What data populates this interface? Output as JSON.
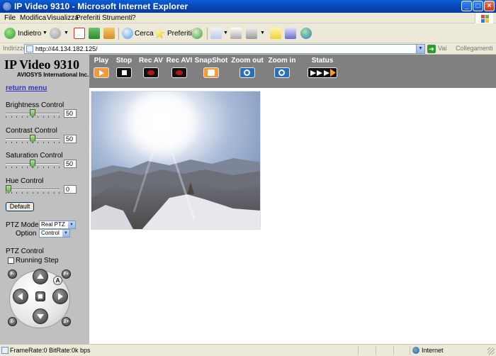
{
  "window": {
    "title": "IP Video 9310 - Microsoft Internet Explorer",
    "controls": {
      "minimize": "_",
      "maximize": "□",
      "close": "×"
    }
  },
  "menu": [
    "File",
    "Modifica",
    "Visualizza",
    "Preferiti",
    "Strumenti",
    "?"
  ],
  "toolbar": {
    "back": "Indietro",
    "search": "Cerca",
    "favorites": "Preferiti"
  },
  "address": {
    "label": "Indirizzo",
    "url": "http://44.134.182.125/",
    "go": "Vai",
    "links": "Collegamenti"
  },
  "controls_bar": {
    "buttons": [
      {
        "label": "Play",
        "icon": "play-icon"
      },
      {
        "label": "Stop",
        "icon": "stop-icon"
      },
      {
        "label": "Rec AV",
        "icon": "record-icon"
      },
      {
        "label": "Rec AVI",
        "icon": "record-icon"
      },
      {
        "label": "SnapShot",
        "icon": "camera-icon"
      },
      {
        "label": "Zoom out",
        "icon": "zoom-out-icon"
      },
      {
        "label": "Zoom in",
        "icon": "zoom-in-icon"
      },
      {
        "label": "Status",
        "icon": "status-icon"
      }
    ]
  },
  "sidebar": {
    "brand_title": "IP Video 9310",
    "brand_subtitle": "AVIOSYS International Inc.",
    "return_link": "return menu",
    "brightness": {
      "label": "Brightness Control",
      "value": "50",
      "level": 0.5
    },
    "contrast": {
      "label": "Contrast Control",
      "value": "50",
      "level": 0.5
    },
    "saturation": {
      "label": "Saturation Control",
      "value": "50",
      "level": 0.5
    },
    "hue": {
      "label": "Hue Control",
      "value": "0",
      "level": 0.0
    },
    "default_button": "Default",
    "ptz_mode": {
      "label": "PTZ Mode",
      "value": "Real PTZ"
    },
    "option": {
      "label": "Option",
      "value": "Control"
    },
    "ptz_control": {
      "label": "PTZ Control",
      "running_step": "Running Step",
      "auto_button": "A"
    },
    "ptz_small": {
      "focus_minus": "F-",
      "focus_plus": "F+",
      "zoom_minus": "Z-",
      "zoom_plus": "Z+"
    }
  },
  "status": {
    "text": "FrameRate:0 BitRate:0k bps",
    "zone": "Internet"
  },
  "colors": {
    "title_bar": "#0A4FCC",
    "control_bar": "#808080",
    "sidebar": "#C0C0C0",
    "link": "#3333CC",
    "icon_orange": "#F39A3A",
    "icon_red": "#B01818"
  }
}
